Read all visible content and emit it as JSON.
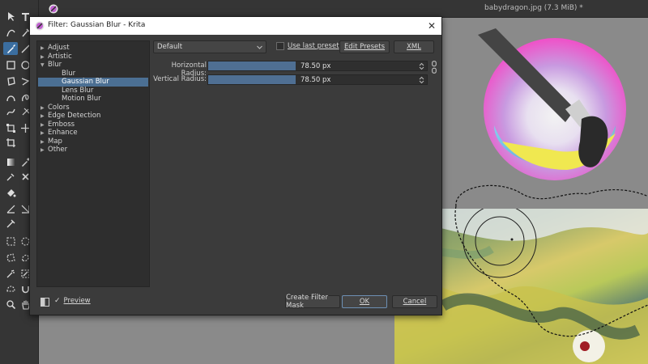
{
  "document": {
    "title": "babydragon.jpg (7.3 MiB) *"
  },
  "dialog": {
    "title": "Filter: Gaussian Blur - Krita",
    "close_symbol": "✕"
  },
  "filters": {
    "categories": [
      {
        "label": "Adjust",
        "expanded": false
      },
      {
        "label": "Artistic",
        "expanded": false
      },
      {
        "label": "Blur",
        "expanded": true,
        "children": [
          "Blur",
          "Gaussian Blur",
          "Lens Blur",
          "Motion Blur"
        ]
      },
      {
        "label": "Colors",
        "expanded": false
      },
      {
        "label": "Edge Detection",
        "expanded": false
      },
      {
        "label": "Emboss",
        "expanded": false
      },
      {
        "label": "Enhance",
        "expanded": false
      },
      {
        "label": "Map",
        "expanded": false
      },
      {
        "label": "Other",
        "expanded": false
      }
    ],
    "selected": "Gaussian Blur"
  },
  "preset": {
    "value": "Default",
    "use_last_label": "Use last preset",
    "use_last_checked": false,
    "edit_presets_label": "Edit Presets",
    "xml_label": "XML"
  },
  "params": {
    "horizontal": {
      "label": "Horizontal Radius:",
      "value": "78.50 px",
      "fraction": 0.4
    },
    "vertical": {
      "label": "Vertical Radius:",
      "value": "78.50 px",
      "fraction": 0.4
    }
  },
  "footer": {
    "preview_label": "Preview",
    "preview_checked": true,
    "create_mask_label": "Create Filter Mask",
    "ok_label": "OK",
    "cancel_label": "Cancel"
  },
  "colors": {
    "accent": "#4b6f93",
    "dialog_bg": "#3b3b3b",
    "canvas_bg": "#8a8a8a"
  }
}
